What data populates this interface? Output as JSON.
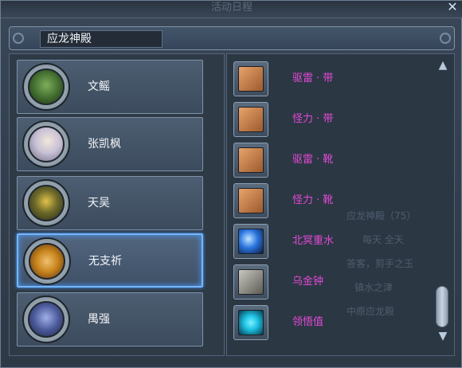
{
  "window": {
    "title_ghost": "活动日程",
    "close_icon": "close-icon"
  },
  "header": {
    "title": "应龙神殿"
  },
  "npcs": [
    {
      "name": "文鳐",
      "avatar_color": "#4f7a3a"
    },
    {
      "name": "张凯枫",
      "avatar_color": "#c9c3d8"
    },
    {
      "name": "天吴",
      "avatar_color": "#6f6a2a"
    },
    {
      "name": "无支祈",
      "avatar_color": "#c8861e"
    },
    {
      "name": "禺强",
      "avatar_color": "#4c5a9a"
    }
  ],
  "selected_npc": "无支祈",
  "items": [
    {
      "name": "驱雷 · 带",
      "icon": "bracer-icon",
      "color": "#b8733f"
    },
    {
      "name": "怪力 · 带",
      "icon": "bracer-icon",
      "color": "#b8733f"
    },
    {
      "name": "驱雷 · 靴",
      "icon": "bracer-icon",
      "color": "#b8733f"
    },
    {
      "name": "怪力 · 靴",
      "icon": "bracer-icon",
      "color": "#b8733f"
    },
    {
      "name": "北冥重水",
      "icon": "water-orbs-icon",
      "color": "#2a74e0"
    },
    {
      "name": "乌金钟",
      "icon": "bell-icon",
      "color": "#8f8f86"
    },
    {
      "name": "领悟值",
      "icon": "head-silhouette-icon",
      "color": "#1fc4e6"
    }
  ],
  "ghost_text": {
    "line1": "应龙神殿（75）",
    "line2": "每天  全天",
    "line3": "答客，剪手之玉",
    "line4": "镇水之津",
    "line5": "中原应龙殿"
  },
  "colors": {
    "item_text": "#e24ad6",
    "selected_border": "#74b6ff"
  }
}
